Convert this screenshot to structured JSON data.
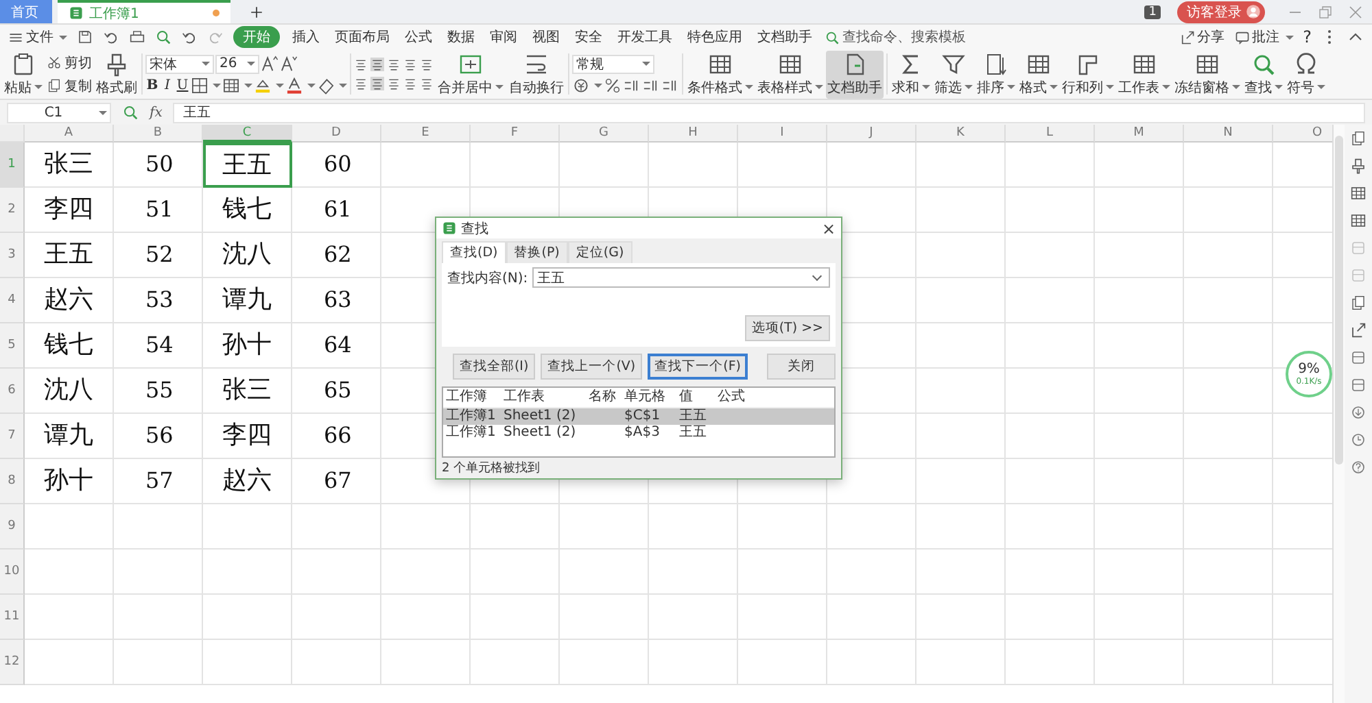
{
  "tabs": [
    {
      "label": "首页",
      "kind": "home",
      "selected": false
    },
    {
      "label": "工作簿1",
      "kind": "doc",
      "selected": true,
      "modified": true
    }
  ],
  "account": {
    "notice": "1",
    "login": "访客登录"
  },
  "menu": {
    "file": "文件",
    "items": [
      {
        "label": "开始",
        "selected": true
      },
      {
        "label": "插入",
        "selected": false
      },
      {
        "label": "页面布局",
        "selected": false
      },
      {
        "label": "公式",
        "selected": false
      },
      {
        "label": "数据",
        "selected": false
      },
      {
        "label": "审阅",
        "selected": false
      },
      {
        "label": "视图",
        "selected": false
      },
      {
        "label": "安全",
        "selected": false
      },
      {
        "label": "开发工具",
        "selected": false
      },
      {
        "label": "特色应用",
        "selected": false
      },
      {
        "label": "文档助手",
        "selected": false
      }
    ],
    "search": {
      "placeholder": "查找命令、搜索模板"
    },
    "share": "分享",
    "comment": "批注",
    "help": "?"
  },
  "ribbon": {
    "paste": "粘贴",
    "cut": "剪切",
    "copy": "复制",
    "format_painter": "格式刷",
    "font_name": "宋体",
    "font_size": "26",
    "format_buttons": [
      "B",
      "I",
      "U"
    ],
    "merge": "合并居中",
    "wrap": "自动换行",
    "number_format": "常规",
    "tools": [
      {
        "label": "条件格式",
        "dropdown": true,
        "selected": false
      },
      {
        "label": "表格样式",
        "dropdown": true,
        "selected": false
      },
      {
        "label": "文档助手",
        "dropdown": false,
        "selected": true
      },
      {
        "label": "求和",
        "dropdown": true,
        "selected": false
      },
      {
        "label": "筛选",
        "dropdown": true,
        "selected": false
      },
      {
        "label": "排序",
        "dropdown": true,
        "selected": false
      },
      {
        "label": "格式",
        "dropdown": true,
        "selected": false
      },
      {
        "label": "行和列",
        "dropdown": true,
        "selected": false
      },
      {
        "label": "工作表",
        "dropdown": true,
        "selected": false
      },
      {
        "label": "冻结窗格",
        "dropdown": true,
        "selected": false
      },
      {
        "label": "查找",
        "dropdown": true,
        "selected": false
      },
      {
        "label": "符号",
        "dropdown": true,
        "selected": false
      }
    ]
  },
  "formula_bar": {
    "name_box": "C1",
    "fx": "fx",
    "value": "王五"
  },
  "sheet": {
    "columns": [
      {
        "label": "A",
        "selected": false
      },
      {
        "label": "B",
        "selected": false
      },
      {
        "label": "C",
        "selected": true
      },
      {
        "label": "D",
        "selected": false
      },
      {
        "label": "E",
        "selected": false
      },
      {
        "label": "F",
        "selected": false
      },
      {
        "label": "G",
        "selected": false
      },
      {
        "label": "H",
        "selected": false
      },
      {
        "label": "I",
        "selected": false
      },
      {
        "label": "J",
        "selected": false
      },
      {
        "label": "K",
        "selected": false
      },
      {
        "label": "L",
        "selected": false
      },
      {
        "label": "M",
        "selected": false
      },
      {
        "label": "N",
        "selected": false
      },
      {
        "label": "O",
        "selected": false
      }
    ],
    "rows": [
      {
        "header": "1",
        "selected": true,
        "cells": [
          "张三",
          "50",
          "王五",
          "60"
        ]
      },
      {
        "header": "2",
        "selected": false,
        "cells": [
          "李四",
          "51",
          "钱七",
          "61"
        ]
      },
      {
        "header": "3",
        "selected": false,
        "cells": [
          "王五",
          "52",
          "沈八",
          "62"
        ]
      },
      {
        "header": "4",
        "selected": false,
        "cells": [
          "赵六",
          "53",
          "谭九",
          "63"
        ]
      },
      {
        "header": "5",
        "selected": false,
        "cells": [
          "钱七",
          "54",
          "孙十",
          "64"
        ]
      },
      {
        "header": "6",
        "selected": false,
        "cells": [
          "沈八",
          "55",
          "张三",
          "65"
        ]
      },
      {
        "header": "7",
        "selected": false,
        "cells": [
          "谭九",
          "56",
          "李四",
          "66"
        ]
      },
      {
        "header": "8",
        "selected": false,
        "cells": [
          "孙十",
          "57",
          "赵六",
          "67"
        ]
      },
      {
        "header": "9",
        "selected": false
      },
      {
        "header": "10",
        "selected": false
      },
      {
        "header": "11",
        "selected": false
      },
      {
        "header": "12",
        "selected": false
      }
    ]
  },
  "dialog": {
    "title": "查找",
    "close": "×",
    "tabs": [
      {
        "label": "查找(D)",
        "selected": true
      },
      {
        "label": "替换(P)",
        "selected": false
      },
      {
        "label": "定位(G)",
        "selected": false
      }
    ],
    "find_label": "查找内容(N):",
    "find_value": "王五",
    "options": "选项(T) >>",
    "buttons": [
      {
        "label": "查找全部(I)",
        "default": false
      },
      {
        "label": "查找上一个(V)",
        "default": false
      },
      {
        "label": "查找下一个(F)",
        "default": true
      },
      {
        "label": "关闭",
        "default": false
      }
    ],
    "results": {
      "columns": [
        "工作簿",
        "工作表",
        "名称",
        "单元格",
        "值",
        "公式"
      ],
      "rows": [
        {
          "cells": [
            "工作簿1",
            "Sheet1 (2)",
            "",
            "$C$1",
            "王五",
            ""
          ],
          "selected": true
        },
        {
          "cells": [
            "工作簿1",
            "Sheet1 (2)",
            "",
            "$A$3",
            "王五",
            ""
          ],
          "selected": false
        }
      ]
    },
    "status": "2 个单元格被找到"
  },
  "speed": {
    "percent": "9%",
    "rate": "0.1K/s"
  }
}
